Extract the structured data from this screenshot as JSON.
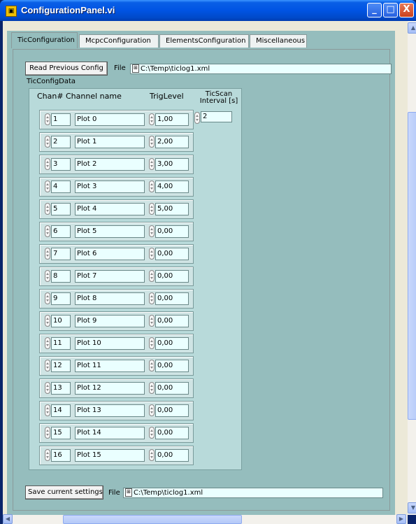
{
  "window": {
    "title": "ConfigurationPanel.vi",
    "minimize_label": "_",
    "maximize_label": "□",
    "close_label": "X"
  },
  "tabs": [
    {
      "label": "TicConfiguration",
      "active": true
    },
    {
      "label": "McpcConfiguration",
      "active": false
    },
    {
      "label": "ElementsConfiguration",
      "active": false
    },
    {
      "label": "Miscellaneous",
      "active": false
    }
  ],
  "top": {
    "read_button": "Read Previous Config",
    "file_label": "File",
    "file_path": "C:\\Temp\\ticlog1.xml"
  },
  "config": {
    "cluster_label": "TicConfigData",
    "headers": {
      "chan": "Chan#",
      "name": "Channel name",
      "trig": "TrigLevel",
      "scan": "TicScan Interval [s]"
    },
    "scan_interval": "2",
    "rows": [
      {
        "chan": "1",
        "name": "Plot 0",
        "trig": "1,00"
      },
      {
        "chan": "2",
        "name": "Plot 1",
        "trig": "2,00"
      },
      {
        "chan": "3",
        "name": "Plot 2",
        "trig": "3,00"
      },
      {
        "chan": "4",
        "name": "Plot 3",
        "trig": "4,00"
      },
      {
        "chan": "5",
        "name": "Plot 4",
        "trig": "5,00"
      },
      {
        "chan": "6",
        "name": "Plot 5",
        "trig": "0,00"
      },
      {
        "chan": "7",
        "name": "Plot 6",
        "trig": "0,00"
      },
      {
        "chan": "8",
        "name": "Plot 7",
        "trig": "0,00"
      },
      {
        "chan": "9",
        "name": "Plot 8",
        "trig": "0,00"
      },
      {
        "chan": "10",
        "name": "Plot 9",
        "trig": "0,00"
      },
      {
        "chan": "11",
        "name": "Plot 10",
        "trig": "0,00"
      },
      {
        "chan": "12",
        "name": "Plot 11",
        "trig": "0,00"
      },
      {
        "chan": "13",
        "name": "Plot 12",
        "trig": "0,00"
      },
      {
        "chan": "14",
        "name": "Plot 13",
        "trig": "0,00"
      },
      {
        "chan": "15",
        "name": "Plot 14",
        "trig": "0,00"
      },
      {
        "chan": "16",
        "name": "Plot 15",
        "trig": "0,00"
      }
    ]
  },
  "bottom": {
    "save_button": "Save current settings",
    "file_label": "File",
    "file_path": "C:\\Temp\\ticlog1.xml"
  },
  "icons": {
    "app": "labview-vi-icon",
    "path": "path-browse-icon",
    "spin": "increment-decrement-icon"
  },
  "colors": {
    "titlebar": "#0054e3",
    "panel": "#95bdbd",
    "cluster": "#b8dada",
    "field": "#eaffff"
  }
}
